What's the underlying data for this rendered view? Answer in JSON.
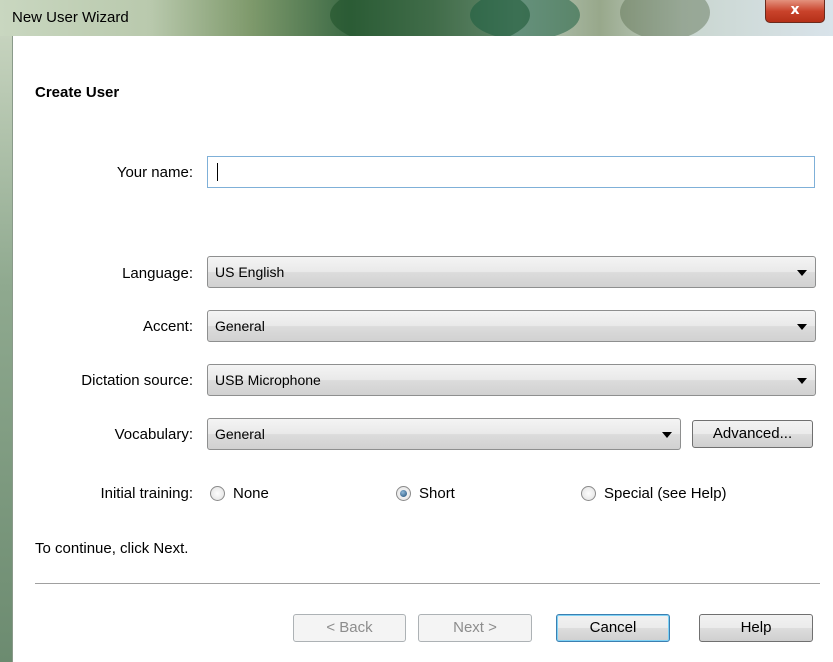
{
  "window": {
    "title": "New User Wizard",
    "close_glyph": "x"
  },
  "page": {
    "heading": "Create User"
  },
  "form": {
    "name_label": "Your name:",
    "name_value": "",
    "language_label": "Language:",
    "language_value": "US English",
    "accent_label": "Accent:",
    "accent_value": "General",
    "source_label": "Dictation source:",
    "source_value": "USB Microphone",
    "vocabulary_label": "Vocabulary:",
    "vocabulary_value": "General",
    "advanced_label": "Advanced...",
    "training_label": "Initial training:",
    "training_options": [
      "None",
      "Short",
      "Special (see Help)"
    ],
    "training_selected": "Short"
  },
  "instruction": "To continue, click Next.",
  "buttons": {
    "back": "< Back",
    "next": "Next >",
    "cancel": "Cancel",
    "help": "Help"
  }
}
